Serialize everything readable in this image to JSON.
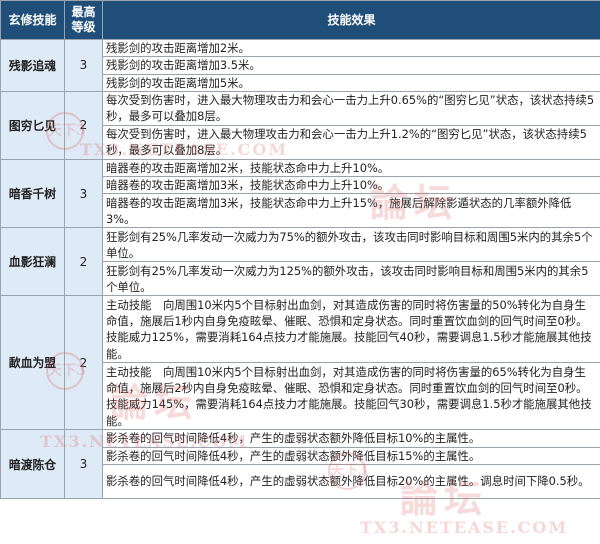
{
  "header": {
    "skill": "玄修技能",
    "level_line1": "最高",
    "level_line2": "等级",
    "effect": "技能效果"
  },
  "groups": [
    {
      "name": "残影追魂",
      "level": "3",
      "effects": [
        "残影剑的攻击距离增加2米。",
        "残影剑的攻击距离增加3.5米。",
        "残影剑的攻击距离增加5米。"
      ]
    },
    {
      "name": "图穷匕见",
      "level": "2",
      "effects": [
        "每次受到伤害时，进入最大物理攻击力和会心一击力上升0.65%的“图穷匕见”状态，该状态持续5秒，最多可以叠加8层。",
        "每次受到伤害时，进入最大物理攻击力和会心一击力上升1.2%的“图穷匕见”状态，该状态持续5秒，最多可以叠加8层。"
      ]
    },
    {
      "name": "暗香千树",
      "level": "3",
      "effects": [
        "暗器卷的攻击距离增加2米，技能状态命中力上升10%。",
        "暗器卷的攻击距离增加3米，技能状态命中力上升10%。",
        "暗器卷的攻击距离增加3米，技能状态命中力上升15%，施展后解除影遁状态的几率额外降低3%。"
      ]
    },
    {
      "name": "血影狂澜",
      "level": "2",
      "effects": [
        "狂影剑有25%几率发动一次威力为75%的额外攻击，该攻击同时影响目标和周围5米内的其余5个单位。",
        "狂影剑有25%几率发动一次威力为125%的额外攻击，该攻击同时影响目标和周围5米内的其余5个单位。"
      ]
    },
    {
      "name": "歃血为盟",
      "level": "2",
      "effects": [
        "主动技能　向周围10米内5个目标射出血剑，对其造成伤害的同时将伤害量的50%转化为自身生命值，施展后1秒内自身免疫眩晕、催眠、恐惧和定身状态。同时重置饮血剑的回气时间至0秒。技能威力125%，需要消耗164点技力才能施展。技能回气40秒，需要调息1.5秒才能施展其他技能。",
        "主动技能　向周围10米内5个目标射出血剑，对其造成伤害的同时将伤害量的65%转化为自身生命值，施展后2秒内自身免疫眩晕、催眠、恐惧和定身状态。同时重置饮血剑的回气时间至0秒。技能威力145%，需要消耗164点技力才能施展。技能回气30秒，需要调息1.5秒才能施展其他技能。"
      ]
    },
    {
      "name": "暗渡陈仓",
      "level": "3",
      "effects": [
        "影杀卷的回气时间降低4秒，产生的虚弱状态额外降低目标10%的主属性。",
        "影杀卷的回气时间降低4秒，产生的虚弱状态额外降低目标15%的主属性。",
        "影杀卷的回气时间降低4秒，产生的虚弱状态额外降低目标20%的主属性。调息时间下降0.5秒。"
      ]
    }
  ],
  "watermark": {
    "brand": "天下3",
    "text": "論坛",
    "url": "TX3.NETEASE.COM"
  }
}
